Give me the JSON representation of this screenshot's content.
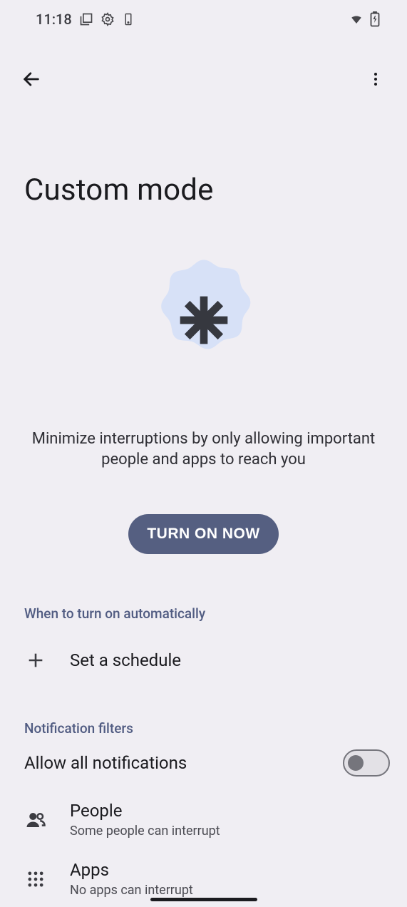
{
  "status": {
    "time": "11:18"
  },
  "page": {
    "title": "Custom mode",
    "description": "Minimize interruptions by only allowing important people and apps to reach you",
    "turn_on_label": "TURN ON NOW"
  },
  "sections": {
    "auto_header": "When to turn on automatically",
    "schedule_label": "Set a schedule",
    "filters_header": "Notification filters",
    "allow_all_label": "Allow all notifications",
    "allow_all_on": false,
    "people": {
      "title": "People",
      "subtitle": "Some people can interrupt"
    },
    "apps": {
      "title": "Apps",
      "subtitle": "No apps can interrupt"
    }
  }
}
